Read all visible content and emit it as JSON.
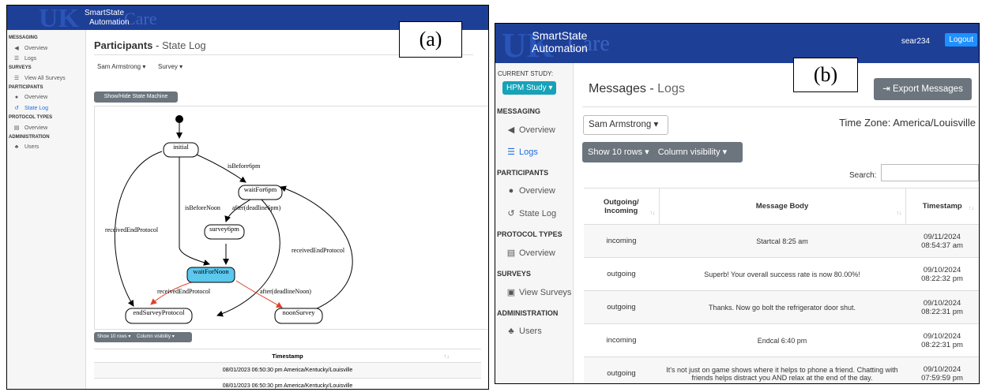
{
  "panel_a": {
    "label": "(a)",
    "brand_line1": "SmartState",
    "brand_line2": "Automation",
    "watermark": "Care",
    "sidebar": [
      {
        "head": "MESSAGING"
      },
      {
        "icon": "send-icon",
        "glyph": "◀",
        "label": "Overview"
      },
      {
        "icon": "list-icon",
        "glyph": "☰",
        "label": "Logs"
      },
      {
        "head": "SURVEYS"
      },
      {
        "icon": "list-icon",
        "glyph": "☰",
        "label": "View All Surveys"
      },
      {
        "head": "PARTICIPANTS"
      },
      {
        "icon": "user-icon",
        "glyph": "●",
        "label": "Overview"
      },
      {
        "icon": "history-icon",
        "glyph": "↺",
        "label": "State Log",
        "active": true
      },
      {
        "head": "PROTOCOL TYPES"
      },
      {
        "icon": "book-icon",
        "glyph": "▤",
        "label": "Overview"
      },
      {
        "head": "ADMINISTRATION"
      },
      {
        "icon": "users-icon",
        "glyph": "♣",
        "label": "Users"
      }
    ],
    "title": "Participants",
    "subtitle": "State Log",
    "participant_select": "Sam Armstrong",
    "survey_select": "Survey",
    "toggle_button": "Show/Hide State Machine",
    "state_machine": {
      "nodes": {
        "initial": "initial",
        "waitFor6pm": "waitFor6pm",
        "survey6pm": "survey6pm",
        "waitForNoon": "waitForNoon",
        "endSurveyProtocol": "endSurveyProtocol",
        "noonSurvey": "noonSurvey"
      },
      "edges": {
        "isBefore6pm": "isBefore6pm",
        "isBeforeNoon": "isBeforeNoon",
        "after_deadline6pm": "after(deadline6pm)",
        "receivedEndProtocol_left": "receivedEndProtocol",
        "receivedEndProtocol_right": "receivedEndProtocol",
        "receivedEndProtocol_mid": "receivedEndProtocol",
        "after_deadlineNoon": "after(deadlineNoon)"
      }
    },
    "rows_button": "Show 10 rows",
    "colvis_button": "Column visibility",
    "table_header": "Timestamp",
    "rows": [
      "08/01/2023 06:50:30 pm America/Kentucky/Louisville",
      "08/01/2023 06:50:30 pm America/Kentucky/Louisville"
    ]
  },
  "panel_b": {
    "label": "(b)",
    "brand_line1": "SmartState",
    "brand_line2": "Automation",
    "watermark": "Care",
    "username": "sear234",
    "logout": "Logout",
    "current_study_label": "CURRENT STUDY:",
    "current_study": "HPM Study",
    "sidebar": [
      {
        "head": "MESSAGING"
      },
      {
        "icon": "send-icon",
        "glyph": "◀",
        "label": "Overview"
      },
      {
        "icon": "list-icon",
        "glyph": "☰",
        "label": "Logs",
        "active": true
      },
      {
        "head": "PARTICIPANTS"
      },
      {
        "icon": "user-icon",
        "glyph": "●",
        "label": "Overview"
      },
      {
        "icon": "history-icon",
        "glyph": "↺",
        "label": "State Log"
      },
      {
        "head": "PROTOCOL TYPES"
      },
      {
        "icon": "book-icon",
        "glyph": "▤",
        "label": "Overview"
      },
      {
        "head": "SURVEYS"
      },
      {
        "icon": "survey-icon",
        "glyph": "▣",
        "label": "View Surveys"
      },
      {
        "head": "ADMINISTRATION"
      },
      {
        "icon": "users-icon",
        "glyph": "♣",
        "label": "Users"
      }
    ],
    "title": "Messages",
    "subtitle": "Logs",
    "export_button": "Export Messages",
    "participant_select": "Sam Armstrong",
    "timezone": "Time Zone: America/Louisville",
    "rows_button": "Show 10 rows",
    "colvis_button": "Column visibility",
    "search_label": "Search:",
    "columns": [
      "Outgoing/ Incoming",
      "Message Body",
      "Timestamp"
    ],
    "rows": [
      {
        "dir": "incoming",
        "body": "Startcal 8:25 am",
        "date": "09/11/2024",
        "time": "08:54:37 am"
      },
      {
        "dir": "outgoing",
        "body": "Superb! Your overall success rate is now 80.00%!",
        "date": "09/10/2024",
        "time": "08:22:32 pm"
      },
      {
        "dir": "outgoing",
        "body": "Thanks. Now go bolt the refrigerator door shut.",
        "date": "09/10/2024",
        "time": "08:22:31 pm"
      },
      {
        "dir": "incoming",
        "body": "Endcal 6:40 pm",
        "date": "09/10/2024",
        "time": "08:22:31 pm"
      },
      {
        "dir": "outgoing",
        "body": "It's not just on game shows where it helps to phone a friend. Chatting with friends helps distract you AND relax at the end of the day.",
        "date": "09/10/2024",
        "time": "07:59:59 pm"
      }
    ]
  }
}
